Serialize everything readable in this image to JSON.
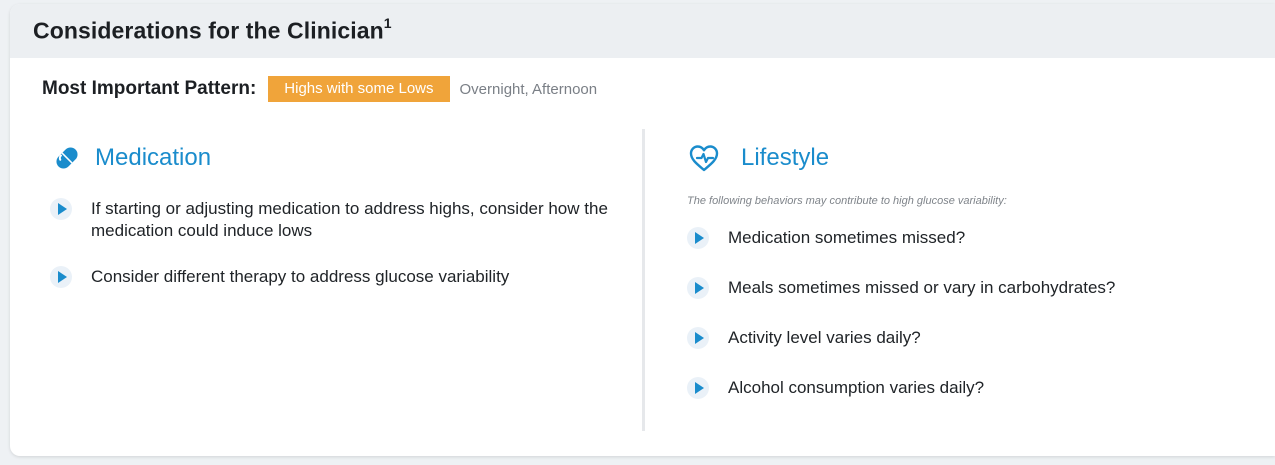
{
  "header": {
    "title": "Considerations for the Clinician",
    "title_sup": "1"
  },
  "pattern": {
    "label": "Most Important Pattern:",
    "badge": "Highs with some Lows",
    "badge_color": "#f0a43a",
    "times": "Overnight, Afternoon"
  },
  "medication": {
    "icon": "pill-icon",
    "title": "Medication",
    "items": [
      "If starting or adjusting medication to address highs, consider how the medication could induce lows",
      "Consider different therapy to address glucose variability"
    ]
  },
  "lifestyle": {
    "icon": "heart-pulse-icon",
    "title": "Lifestyle",
    "intro": "The following behaviors may contribute to high glucose variability:",
    "items": [
      "Medication sometimes missed?",
      "Meals sometimes missed or vary in carbohydrates?",
      "Activity level varies daily?",
      "Alcohol consumption varies daily?"
    ]
  },
  "colors": {
    "accent": "#1a8ccc",
    "header_bg": "#eceff2"
  }
}
